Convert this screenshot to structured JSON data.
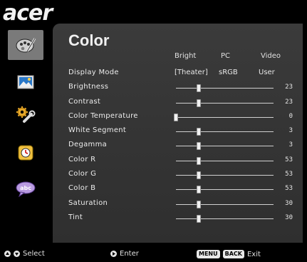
{
  "brand": {
    "name": "acer"
  },
  "sidebar": {
    "items": [
      {
        "icon": "color-palette-icon",
        "active": true
      },
      {
        "icon": "image-icon",
        "active": false
      },
      {
        "icon": "settings-wrench-icon",
        "active": false
      },
      {
        "icon": "clock-timer-icon",
        "active": false
      },
      {
        "icon": "language-abc-icon",
        "active": false
      }
    ]
  },
  "menu": {
    "title": "Color",
    "mode_headers": [
      "Bright",
      "PC",
      "Video"
    ],
    "display_mode": {
      "label": "Display Mode",
      "options": [
        "[Theater]",
        "sRGB",
        "User"
      ],
      "selected": "[Theater]"
    },
    "settings": [
      {
        "label": "Brightness",
        "value": "23",
        "level": 0.23
      },
      {
        "label": "Contrast",
        "value": "23",
        "level": 0.23
      },
      {
        "label": "Color Temperature",
        "value": "0",
        "level": 0.0
      },
      {
        "label": "White Segment",
        "value": "3",
        "level": 0.23
      },
      {
        "label": "Degamma",
        "value": "3",
        "level": 0.23
      },
      {
        "label": "Color R",
        "value": "53",
        "level": 0.23
      },
      {
        "label": "Color G",
        "value": "53",
        "level": 0.23
      },
      {
        "label": "Color B",
        "value": "53",
        "level": 0.23
      },
      {
        "label": "Saturation",
        "value": "30",
        "level": 0.23
      },
      {
        "label": "Tint",
        "value": "30",
        "level": 0.23
      }
    ]
  },
  "footer": {
    "select_label": "Select",
    "enter_label": "Enter",
    "menu_key": "MENU",
    "back_key": "BACK",
    "exit_label": "Exit"
  }
}
